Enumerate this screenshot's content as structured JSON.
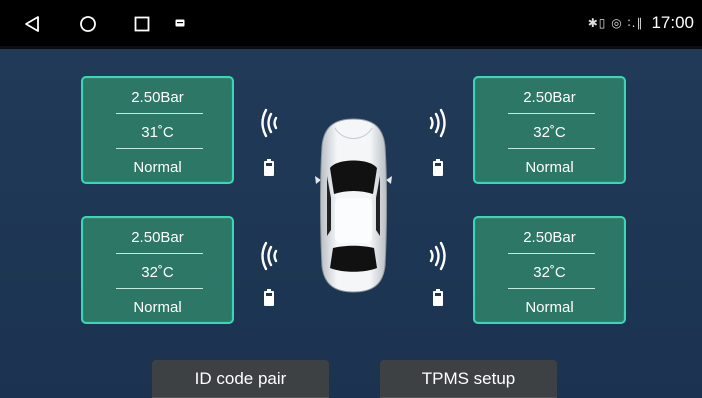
{
  "status_bar": {
    "time": "17:00",
    "indicators": "✱▯ ◎  ∶.∥",
    "icons": [
      "back-icon",
      "home-icon",
      "recents-icon",
      "notification-icon",
      "bluetooth-icon",
      "battery-icon",
      "location-icon",
      "signal-icon"
    ]
  },
  "tires": {
    "front_left": {
      "pressure": "2.50Bar",
      "temperature": "31˚C",
      "status": "Normal"
    },
    "front_right": {
      "pressure": "2.50Bar",
      "temperature": "32˚C",
      "status": "Normal"
    },
    "rear_left": {
      "pressure": "2.50Bar",
      "temperature": "32˚C",
      "status": "Normal"
    },
    "rear_right": {
      "pressure": "2.50Bar",
      "temperature": "32˚C",
      "status": "Normal"
    }
  },
  "buttons": {
    "id_code_pair": "ID code pair",
    "tpms_setup": "TPMS setup"
  },
  "colors": {
    "card_fill": "#2c7765",
    "card_border": "#39d6b7",
    "background": "#1d3653",
    "status_bar": "#000000",
    "button": "#3d4144"
  }
}
